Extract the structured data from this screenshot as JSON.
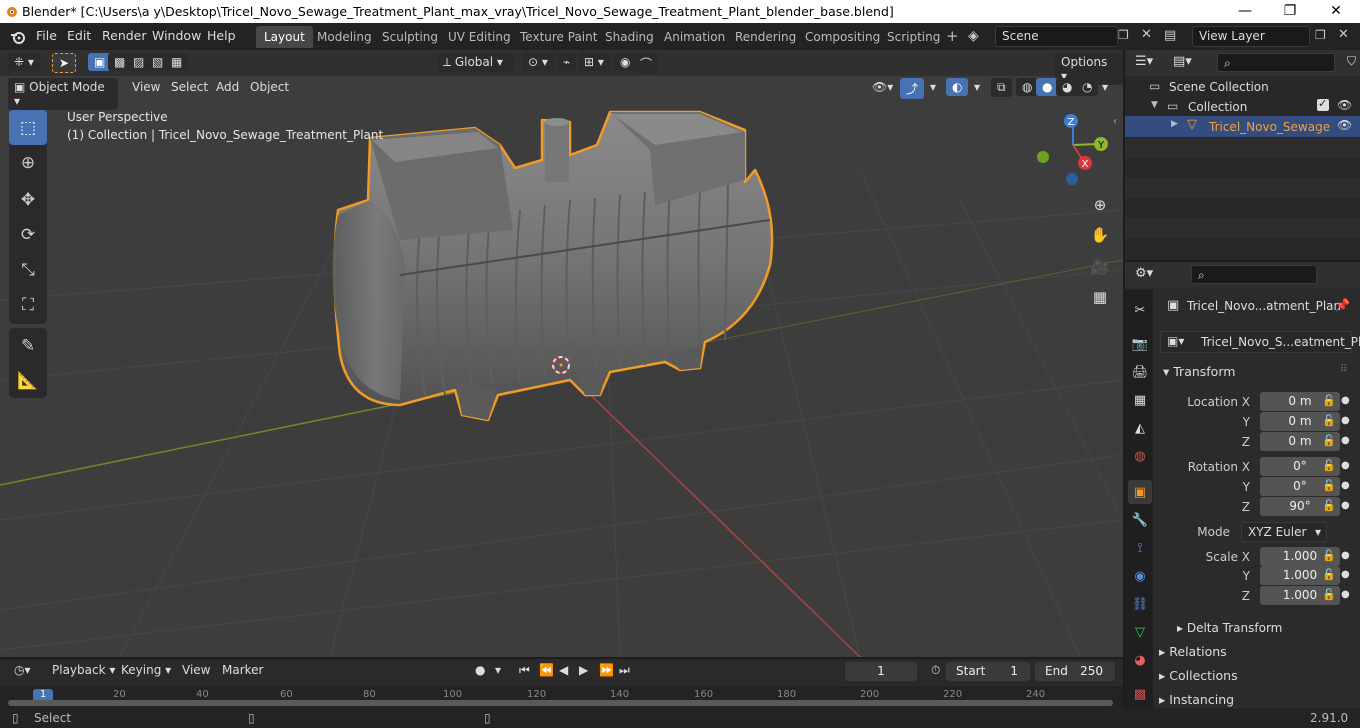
{
  "window": {
    "title": "Blender* [C:\\Users\\a y\\Desktop\\Tricel_Novo_Sewage_Treatment_Plant_max_vray\\Tricel_Novo_Sewage_Treatment_Plant_blender_base.blend]",
    "minimize": "—",
    "maximize": "❐",
    "close": "✕"
  },
  "menu": [
    "File",
    "Edit",
    "Render",
    "Window",
    "Help"
  ],
  "workspaces": [
    "Layout",
    "Modeling",
    "Sculpting",
    "UV Editing",
    "Texture Paint",
    "Shading",
    "Animation",
    "Rendering",
    "Compositing",
    "Scripting"
  ],
  "active_workspace": "Layout",
  "scene_name": "Scene",
  "view_layer": "View Layer",
  "viewport_header": {
    "orientation": "Global",
    "options": "Options",
    "mode": "Object Mode",
    "menus": [
      "View",
      "Select",
      "Add",
      "Object"
    ]
  },
  "viewport": {
    "perspective": "User Perspective",
    "collection_info": "(1) Collection | Tricel_Novo_Sewage_Treatment_Plant",
    "gizmo": {
      "z": "Z",
      "y": "Y",
      "x": "X"
    }
  },
  "outliner": {
    "scene_collection": "Scene Collection",
    "collection": "Collection",
    "object": "Tricel_Novo_Sewage"
  },
  "properties": {
    "object_name": "Tricel_Novo...atment_Plan",
    "data_name": "Tricel_Novo_S...eatment_Plant",
    "transform_label": "Transform",
    "location": {
      "label_x": "Location X",
      "x": "0 m",
      "y": "0 m",
      "z": "0 m"
    },
    "rotation": {
      "label_x": "Rotation X",
      "x": "0°",
      "y": "0°",
      "z": "90°"
    },
    "mode_label": "Mode",
    "mode_value": "XYZ Euler",
    "scale": {
      "label_x": "Scale X",
      "x": "1.000",
      "y": "1.000",
      "z": "1.000"
    },
    "axis_y": "Y",
    "axis_z": "Z",
    "delta_transform": "Delta Transform",
    "relations": "Relations",
    "collections": "Collections",
    "instancing": "Instancing"
  },
  "timeline": {
    "menus": [
      "Playback",
      "Keying",
      "View",
      "Marker"
    ],
    "current_frame": "1",
    "start_label": "Start",
    "start": "1",
    "end_label": "End",
    "end": "250",
    "ticks": [
      "20",
      "40",
      "60",
      "80",
      "100",
      "120",
      "140",
      "160",
      "180",
      "200",
      "220",
      "240"
    ],
    "cursor_frame": "1"
  },
  "status": {
    "left": "Select",
    "version": "2.91.0"
  },
  "colors": {
    "accent": "#4772b3",
    "selection_outline": "#f29b26",
    "x_axis": "#d9363e",
    "y_axis": "#8cb82c",
    "z_axis": "#3b7fd8"
  }
}
